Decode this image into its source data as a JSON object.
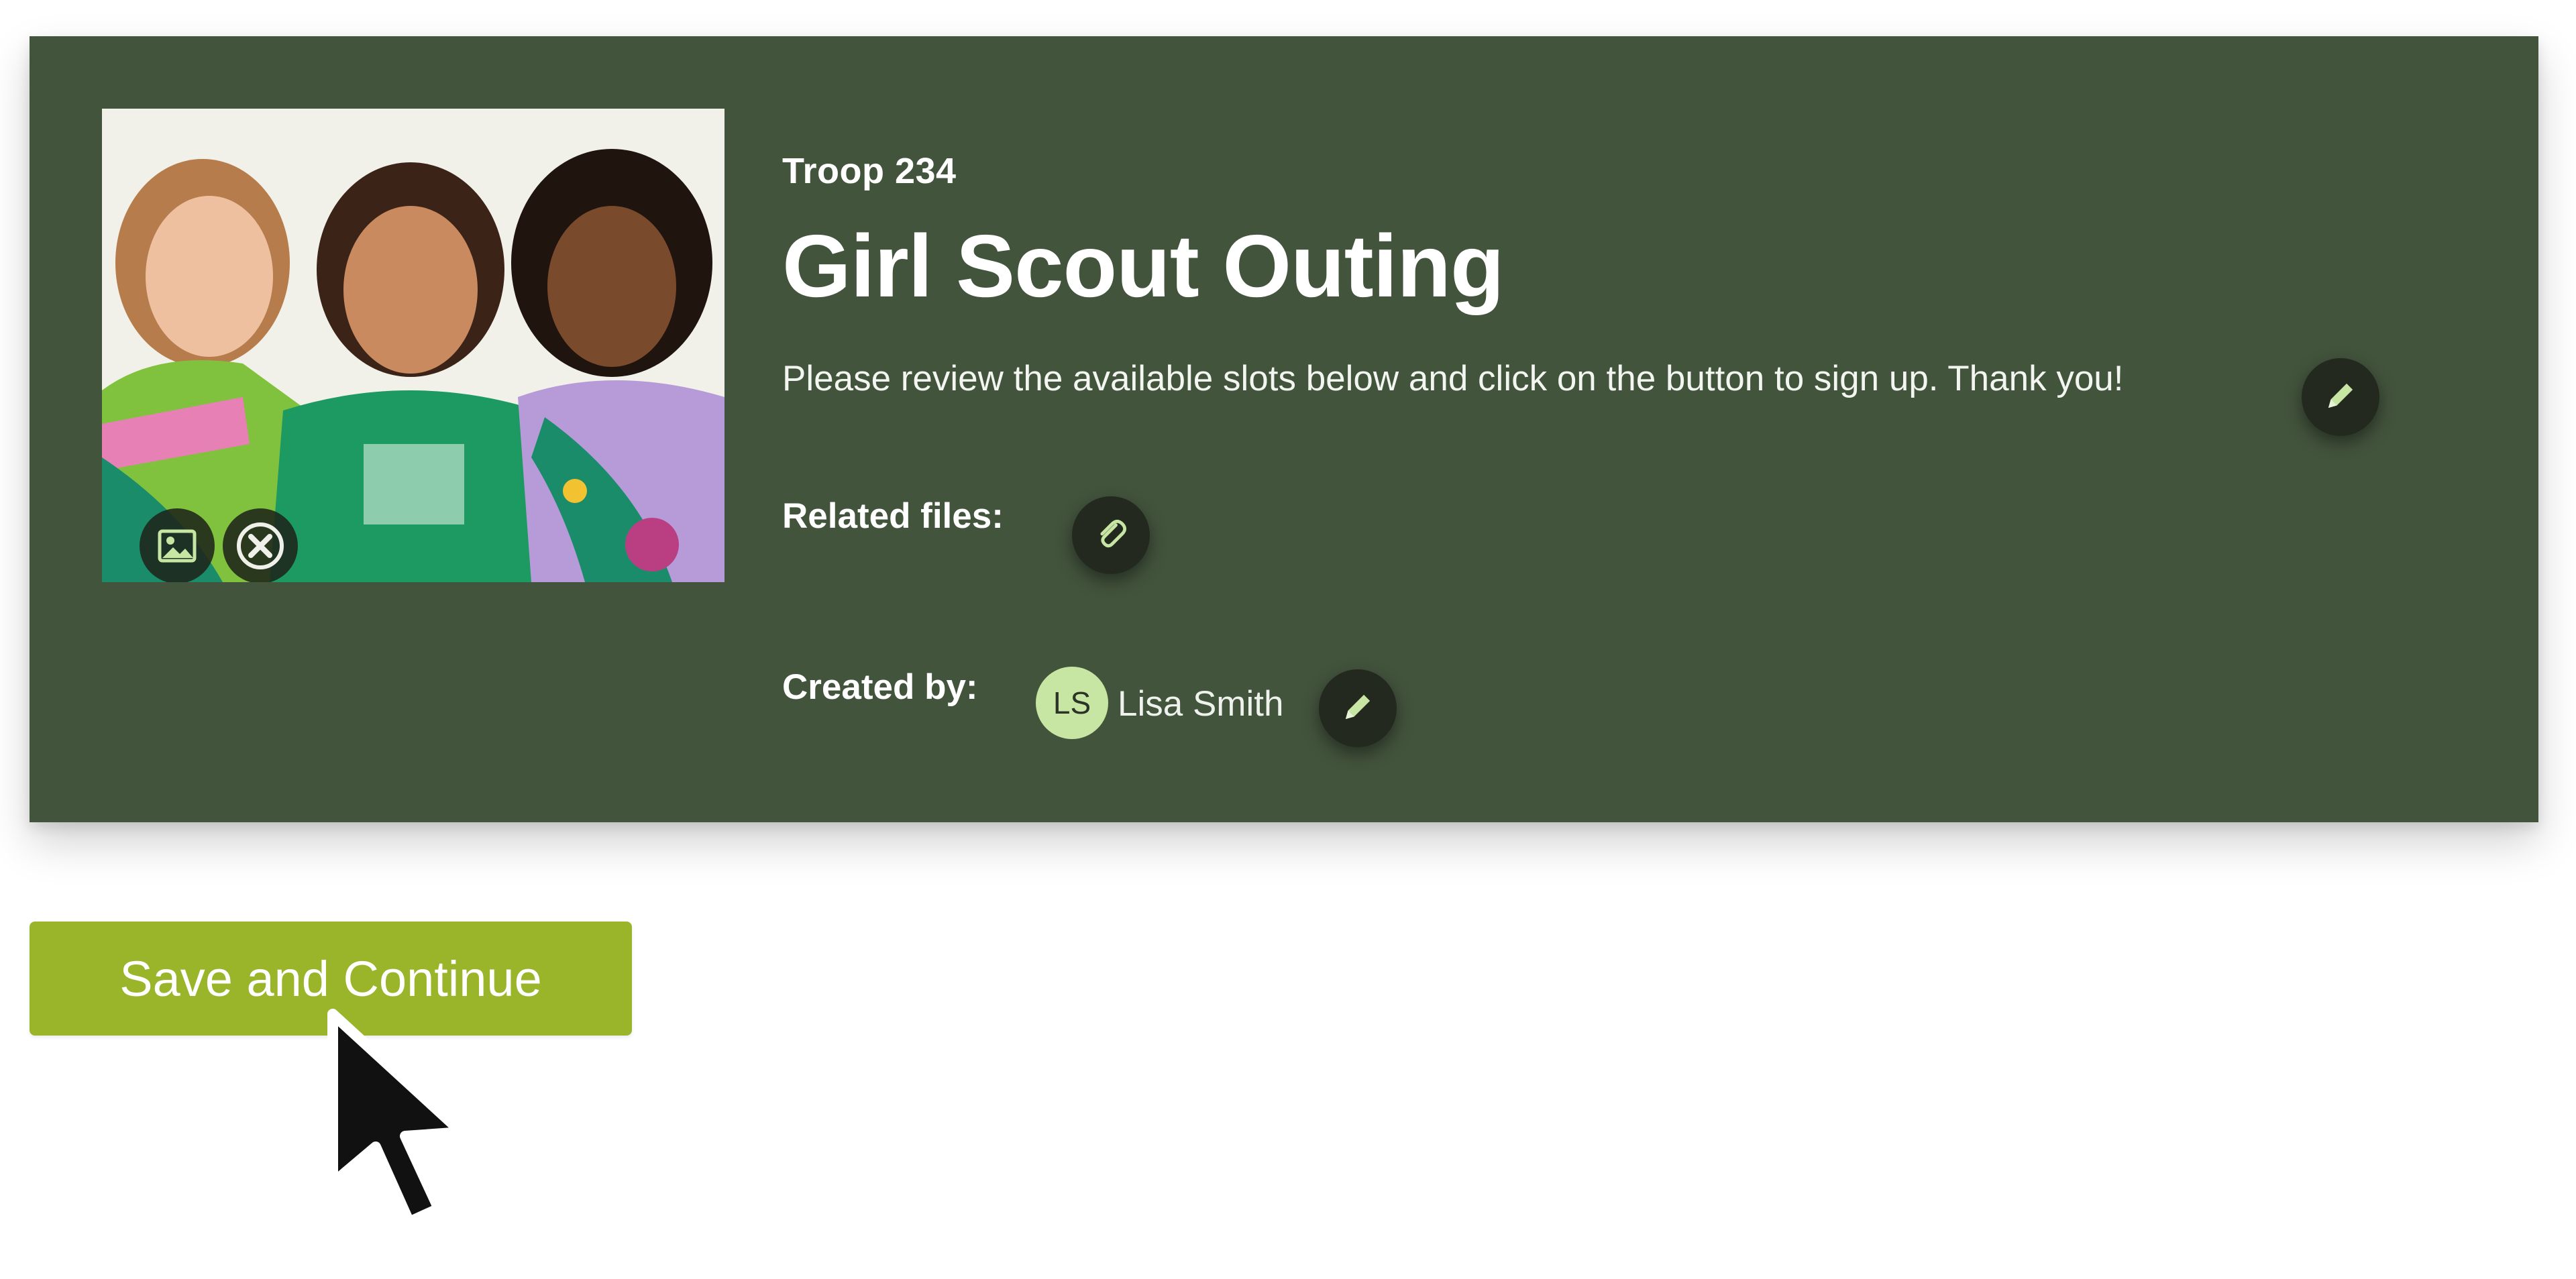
{
  "event": {
    "troop": "Troop 234",
    "title": "Girl Scout Outing",
    "description": "Please review the available slots below and click on the button to sign up. Thank you!",
    "image_icons": [
      "image-icon",
      "close-icon"
    ]
  },
  "related_files": {
    "label": "Related files:",
    "icon": "paperclip-icon"
  },
  "creator": {
    "label": "Created by:",
    "initials": "LS",
    "name": "Lisa Smith",
    "edit_icon": "pencil-icon"
  },
  "actions": {
    "save_label": "Save and Continue"
  },
  "colors": {
    "header_background": "#43543d",
    "button": "#9ab52a",
    "avatar": "#c8e6a3",
    "icon_accent": "#c8e6a3"
  }
}
